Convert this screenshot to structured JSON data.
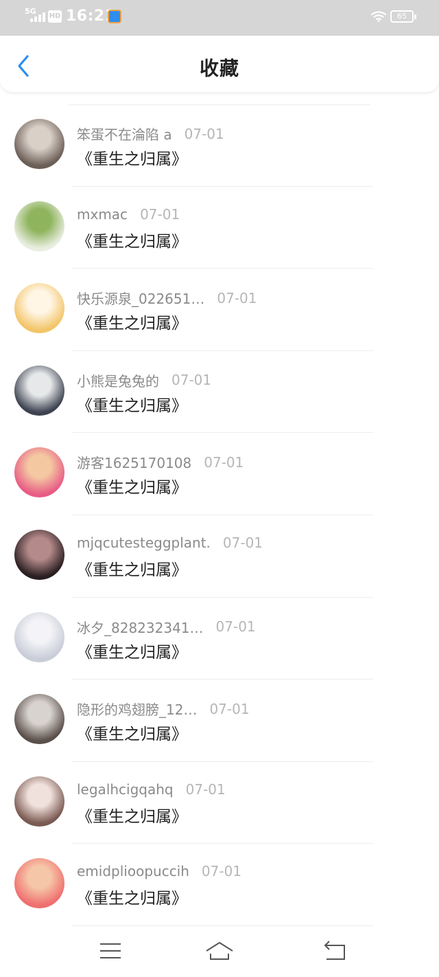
{
  "status_bar": {
    "network": "5G",
    "hd": "HD",
    "time": "16:21",
    "battery": "65",
    "icons": [
      "signal-icon",
      "hd-icon",
      "app-notification-icon",
      "wifi-icon",
      "battery-icon"
    ]
  },
  "nav": {
    "title": "收藏",
    "back_icon": "chevron-left-icon",
    "accent": "#2a8ef0"
  },
  "favorites": [
    {
      "user": "笨蛋不在淪陷  a",
      "date": "07-01",
      "book": "《重生之归属》",
      "avatar_colors": [
        "#6b5e57",
        "#d9d0c8"
      ]
    },
    {
      "user": "mxmac",
      "date": "07-01",
      "book": "《重生之归属》",
      "avatar_colors": [
        "#e9eee1",
        "#8fb45e"
      ]
    },
    {
      "user": "快乐源泉_022651…",
      "date": "07-01",
      "book": "《重生之归属》",
      "avatar_colors": [
        "#f3c56a",
        "#fff6e6"
      ]
    },
    {
      "user": "小熊是兔兔的",
      "date": "07-01",
      "book": "《重生之归属》",
      "avatar_colors": [
        "#3d4350",
        "#e6e8ea"
      ]
    },
    {
      "user": "游客1625170108",
      "date": "07-01",
      "book": "《重生之归属》",
      "avatar_colors": [
        "#e85c86",
        "#f4c9a2"
      ]
    },
    {
      "user": "mjqcutesteggplant.",
      "date": "07-01",
      "book": "《重生之归属》",
      "avatar_colors": [
        "#2a1f22",
        "#b58a8a"
      ]
    },
    {
      "user": "冰夕_828232341…",
      "date": "07-01",
      "book": "《重生之归属》",
      "avatar_colors": [
        "#c9cdd8",
        "#f4f4f8"
      ]
    },
    {
      "user": "隐形的鸡翅膀_12…",
      "date": "07-01",
      "book": "《重生之归属》",
      "avatar_colors": [
        "#5b4f4a",
        "#d8d3ce"
      ]
    },
    {
      "user": "legalhcigqahq",
      "date": "07-01",
      "book": "《重生之归属》",
      "avatar_colors": [
        "#7a5a52",
        "#f1e1dc"
      ]
    },
    {
      "user": "emidplioopuccih",
      "date": "07-01",
      "book": "《重生之归属》",
      "avatar_colors": [
        "#ef6f6f",
        "#f6c6a8"
      ]
    }
  ],
  "bottom_nav": {
    "icons": [
      "menu-icon",
      "home-icon",
      "back-icon"
    ]
  }
}
